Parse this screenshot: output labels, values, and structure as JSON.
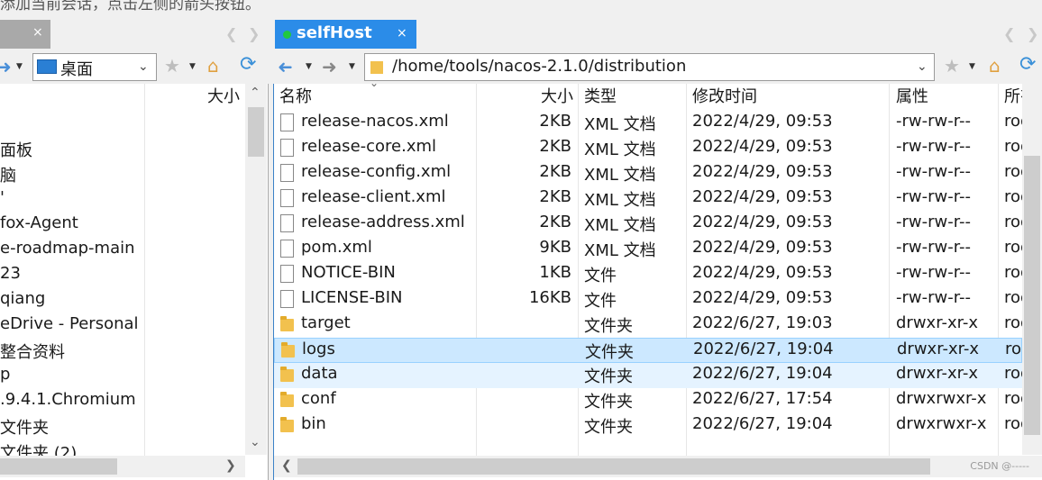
{
  "banner": "添加当前会话，点击左侧的箭头按钮。",
  "left_panel": {
    "tab_close": "×",
    "path": "桌面",
    "column_size": "大小",
    "items": [
      "面板",
      "脑",
      "'",
      "fox-Agent",
      "e-roadmap-main",
      "23",
      "qiang",
      "eDrive - Personal",
      "整合资料",
      "p",
      ".9.4.1.Chromium",
      "文件夹",
      "文件夹 (2)"
    ]
  },
  "right_panel": {
    "tab_label": "selfHost",
    "tab_close": "×",
    "tab_status_color": "#21c840",
    "path": "/home/tools/nacos-2.1.0/distribution",
    "columns": {
      "name": "名称",
      "size": "大小",
      "type": "类型",
      "modified": "修改时间",
      "attributes": "属性",
      "owner": "所有"
    },
    "rows": [
      {
        "icon": "file-icon",
        "name": "release-nacos.xml",
        "size": "2KB",
        "type": "XML 文档",
        "modified": "2022/4/29, 09:53",
        "attrs": "-rw-rw-r--",
        "owner": "roo"
      },
      {
        "icon": "file-icon",
        "name": "release-core.xml",
        "size": "2KB",
        "type": "XML 文档",
        "modified": "2022/4/29, 09:53",
        "attrs": "-rw-rw-r--",
        "owner": "roo"
      },
      {
        "icon": "file-icon",
        "name": "release-config.xml",
        "size": "2KB",
        "type": "XML 文档",
        "modified": "2022/4/29, 09:53",
        "attrs": "-rw-rw-r--",
        "owner": "roo"
      },
      {
        "icon": "file-icon",
        "name": "release-client.xml",
        "size": "2KB",
        "type": "XML 文档",
        "modified": "2022/4/29, 09:53",
        "attrs": "-rw-rw-r--",
        "owner": "roo"
      },
      {
        "icon": "file-icon",
        "name": "release-address.xml",
        "size": "2KB",
        "type": "XML 文档",
        "modified": "2022/4/29, 09:53",
        "attrs": "-rw-rw-r--",
        "owner": "roo"
      },
      {
        "icon": "file-icon",
        "name": "pom.xml",
        "size": "9KB",
        "type": "XML 文档",
        "modified": "2022/4/29, 09:53",
        "attrs": "-rw-rw-r--",
        "owner": "roo"
      },
      {
        "icon": "file-icon",
        "name": "NOTICE-BIN",
        "size": "1KB",
        "type": "文件",
        "modified": "2022/4/29, 09:53",
        "attrs": "-rw-rw-r--",
        "owner": "roo"
      },
      {
        "icon": "file-icon",
        "name": "LICENSE-BIN",
        "size": "16KB",
        "type": "文件",
        "modified": "2022/4/29, 09:53",
        "attrs": "-rw-rw-r--",
        "owner": "roo"
      },
      {
        "icon": "folder-icon",
        "name": "target",
        "size": "",
        "type": "文件夹",
        "modified": "2022/6/27, 19:03",
        "attrs": "drwxr-xr-x",
        "owner": "roo"
      },
      {
        "icon": "folder-icon",
        "name": "logs",
        "size": "",
        "type": "文件夹",
        "modified": "2022/6/27, 19:04",
        "attrs": "drwxr-xr-x",
        "owner": "roo"
      },
      {
        "icon": "folder-icon",
        "name": "data",
        "size": "",
        "type": "文件夹",
        "modified": "2022/6/27, 19:04",
        "attrs": "drwxr-xr-x",
        "owner": "roo"
      },
      {
        "icon": "folder-icon",
        "name": "conf",
        "size": "",
        "type": "文件夹",
        "modified": "2022/6/27, 17:54",
        "attrs": "drwxrwxr-x",
        "owner": "roo"
      },
      {
        "icon": "folder-icon",
        "name": "bin",
        "size": "",
        "type": "文件夹",
        "modified": "2022/6/27, 19:04",
        "attrs": "drwxrwxr-x",
        "owner": "roo"
      }
    ],
    "selected_row": "logs",
    "hover_row": "data"
  },
  "watermark": "CSDN @-----"
}
